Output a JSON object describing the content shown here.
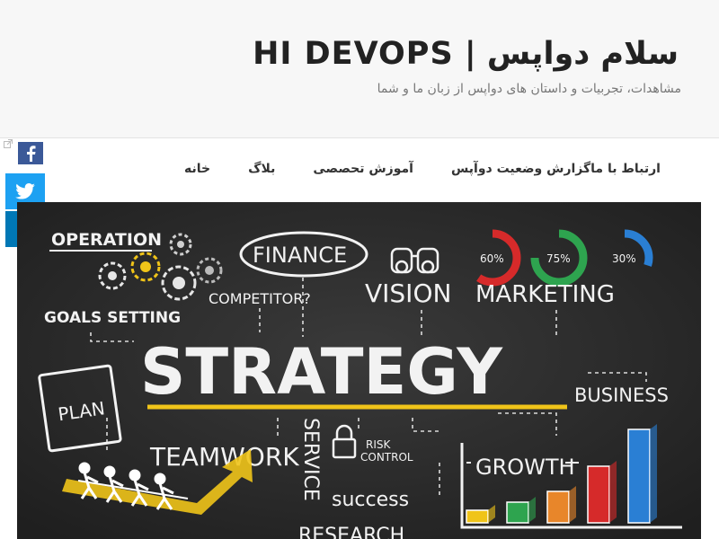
{
  "site": {
    "title": "سلام دواپس | HI DEVOPS",
    "tagline": "مشاهدات، تجربیات و داستان های دواپس از زبان ما و شما"
  },
  "nav": {
    "items": [
      {
        "label": "خانه"
      },
      {
        "label": "بلاگ"
      },
      {
        "label": "آموزش تحصصی"
      },
      {
        "label": "گزارش وضعیت دوآپس"
      },
      {
        "label": "ارتباط با ما"
      }
    ]
  },
  "share": {
    "facebook_icon": "facebook-icon",
    "twitter_icon": "twitter-icon",
    "linkedin_icon": "linkedin-icon",
    "colors": {
      "facebook": "#3b5998",
      "twitter": "#1da1f2",
      "linkedin": "#0077b5"
    }
  },
  "hero": {
    "words": {
      "operation": "OPERATION",
      "finance": "FINANCE",
      "competitor": "COMPETITOR?",
      "vision": "VISION",
      "marketing": "MARKETING",
      "goals": "GOALS SETTING",
      "strategy": "STRATEGY",
      "plan": "PLAN",
      "business": "BUSINESS",
      "teamwork": "TEAMWORK",
      "service": "SERVICE",
      "risk1": "RISK",
      "risk2": "CONTROL",
      "growth": "GROWTH",
      "success": "success",
      "research": "RESEARCH"
    },
    "gauges": [
      {
        "label": "60%",
        "value": 0.6,
        "color": "#d62a2a"
      },
      {
        "label": "75%",
        "value": 0.75,
        "color": "#2ea44f"
      },
      {
        "label": "30%",
        "value": 0.3,
        "color": "#2a7fd4"
      }
    ],
    "bars": [
      {
        "value": 0.12,
        "color": "#f0c419"
      },
      {
        "value": 0.2,
        "color": "#2ea44f"
      },
      {
        "value": 0.3,
        "color": "#e8862a"
      },
      {
        "value": 0.55,
        "color": "#d62a2a"
      },
      {
        "value": 0.9,
        "color": "#2a7fd4"
      }
    ],
    "accent": "#f0c419",
    "board": "#2b2b2b"
  }
}
